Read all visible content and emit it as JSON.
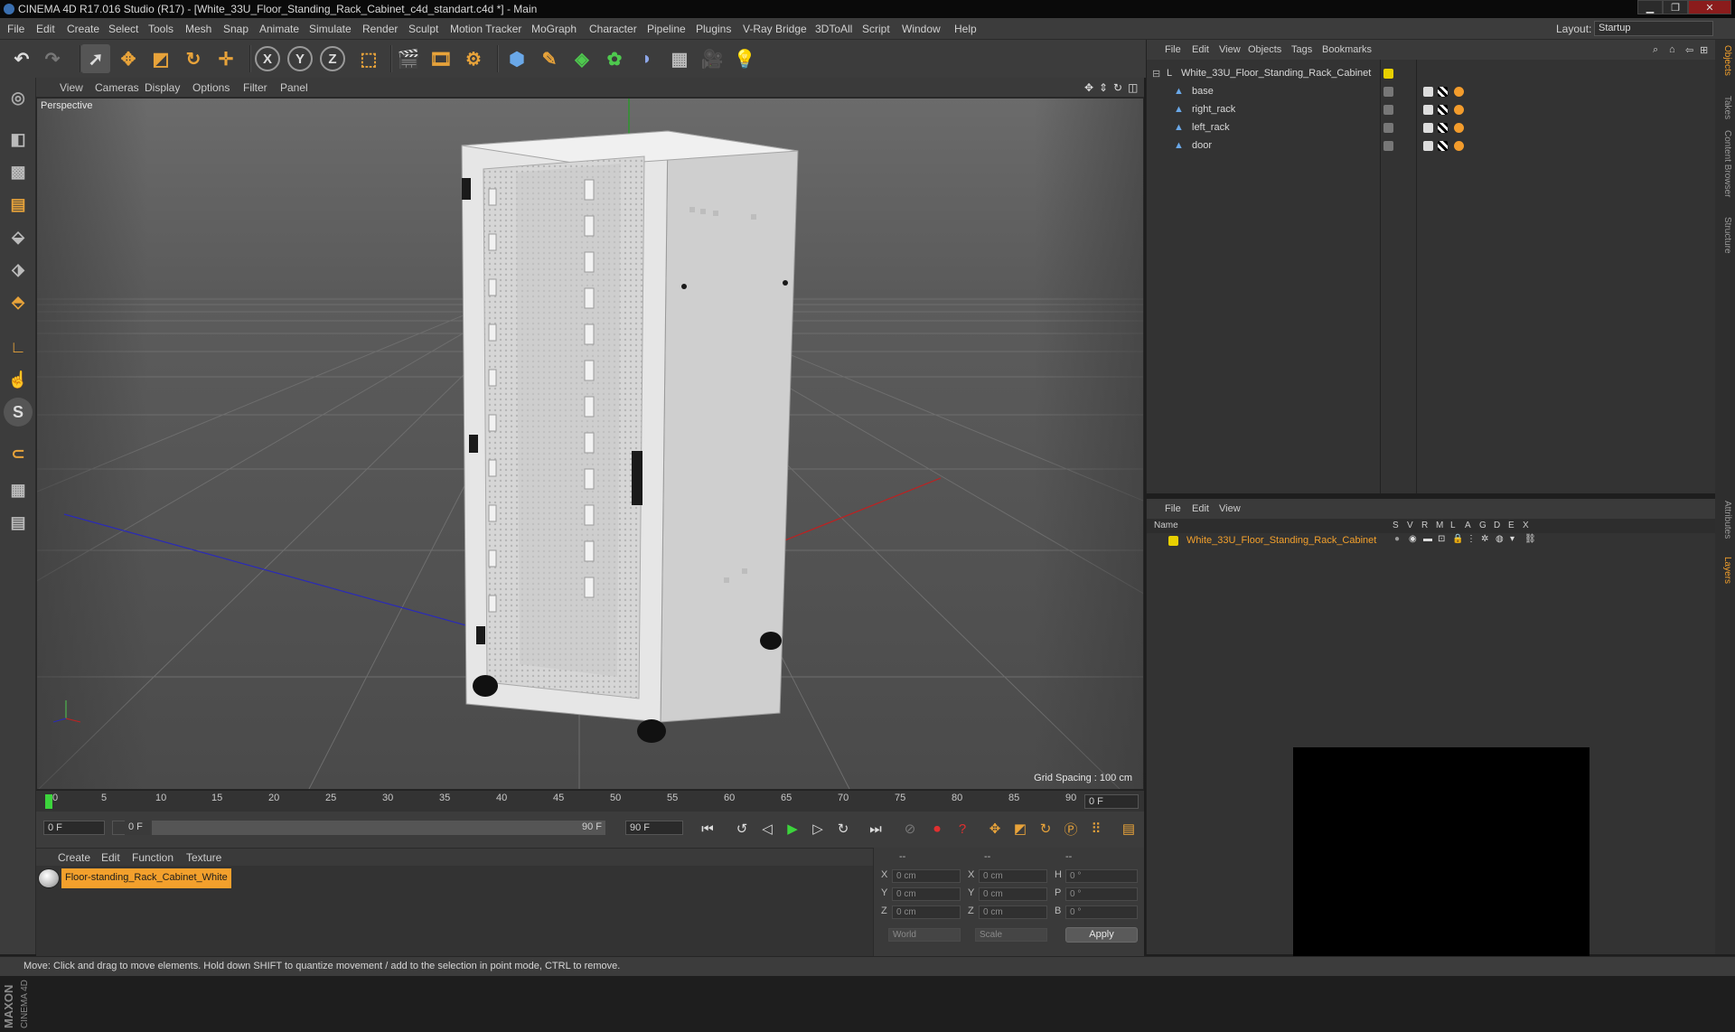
{
  "window": {
    "title": "CINEMA 4D R17.016 Studio (R17) - [White_33U_Floor_Standing_Rack_Cabinet_c4d_standart.c4d *] - Main"
  },
  "menu": [
    "File",
    "Edit",
    "Create",
    "Select",
    "Tools",
    "Mesh",
    "Snap",
    "Animate",
    "Simulate",
    "Render",
    "Sculpt",
    "Motion Tracker",
    "MoGraph",
    "Character",
    "Pipeline",
    "Plugins",
    "V-Ray Bridge",
    "3DToAll",
    "Script",
    "Window",
    "Help"
  ],
  "layout": {
    "label": "Layout:",
    "value": "Startup"
  },
  "viewport": {
    "menu": [
      "View",
      "Cameras",
      "Display",
      "Options",
      "Filter",
      "Panel"
    ],
    "label": "Perspective",
    "grid_spacing": "Grid Spacing : 100 cm"
  },
  "timeline": {
    "ticks": [
      "0",
      "5",
      "10",
      "15",
      "20",
      "25",
      "30",
      "35",
      "40",
      "45",
      "50",
      "55",
      "60",
      "65",
      "70",
      "75",
      "80",
      "85",
      "90"
    ],
    "end_field": "0 F"
  },
  "transport": {
    "start_field": "0 F",
    "range_start": "0 F",
    "range_end": "90 F",
    "end_field": "90 F"
  },
  "material_manager": {
    "menu": [
      "Create",
      "Edit",
      "Function",
      "Texture"
    ],
    "material": "Floor-standing_Rack_Cabinet_White"
  },
  "coordinates": {
    "header": [
      "--",
      "--",
      "--"
    ],
    "rows": [
      {
        "a": "X",
        "v1": "0 cm",
        "b": "X",
        "v2": "0 cm",
        "c": "H",
        "v3": "0 °"
      },
      {
        "a": "Y",
        "v1": "0 cm",
        "b": "Y",
        "v2": "0 cm",
        "c": "P",
        "v3": "0 °"
      },
      {
        "a": "Z",
        "v1": "0 cm",
        "b": "Z",
        "v2": "0 cm",
        "c": "B",
        "v3": "0 °"
      }
    ],
    "mode_world": "World",
    "mode_scale": "Scale",
    "apply": "Apply"
  },
  "object_manager": {
    "menu": [
      "File",
      "Edit",
      "View",
      "Objects",
      "Tags",
      "Bookmarks"
    ],
    "root": "White_33U_Floor_Standing_Rack_Cabinet",
    "children": [
      "base",
      "right_rack",
      "left_rack",
      "door"
    ]
  },
  "layer_manager": {
    "menu": [
      "File",
      "Edit",
      "View"
    ],
    "columns": [
      "Name",
      "S",
      "V",
      "R",
      "M",
      "L",
      "A",
      "G",
      "D",
      "E",
      "X"
    ],
    "layer": "White_33U_Floor_Standing_Rack_Cabinet"
  },
  "side_tabs": [
    "Objects",
    "Takes",
    "Content Browser",
    "Structure",
    "Attributes",
    "Layers"
  ],
  "status": "Move: Click and drag to move elements. Hold down SHIFT to quantize movement / add to the selection in point mode, CTRL to remove.",
  "colors": {
    "accent": "#f3a02c",
    "viewport_bg": "#4a4a4a",
    "layer_color": "#e8d000"
  }
}
